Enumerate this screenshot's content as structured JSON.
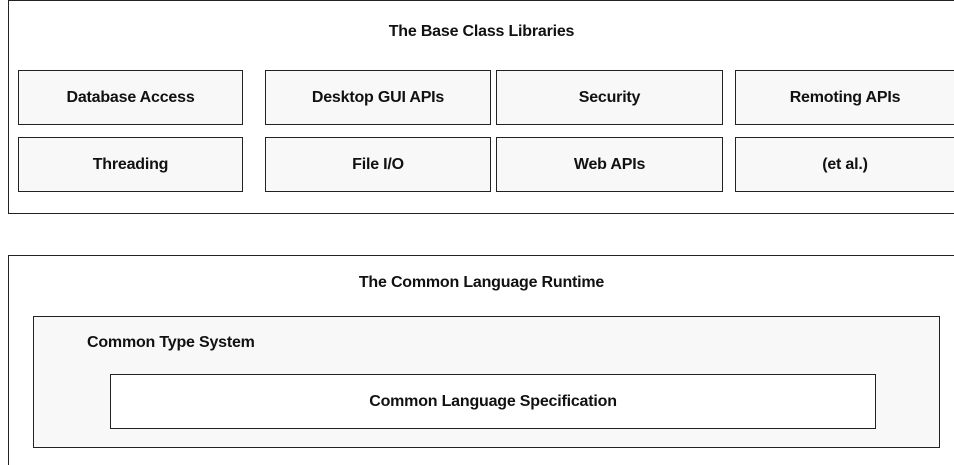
{
  "base_class_libraries": {
    "title": "The Base Class Libraries",
    "row1": [
      "Database Access",
      "Desktop GUI APIs",
      "Security",
      "Remoting APIs"
    ],
    "row2": [
      "Threading",
      "File I/O",
      "Web APIs",
      "(et al.)"
    ]
  },
  "clr": {
    "title": "The Common Language Runtime",
    "cts_label": "Common Type System",
    "cls_label": "Common Language Specification"
  }
}
